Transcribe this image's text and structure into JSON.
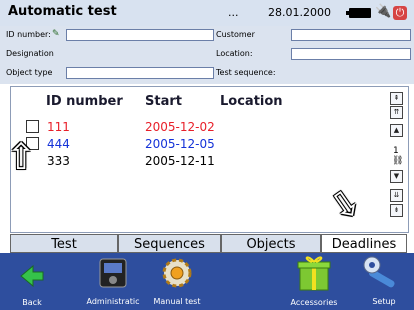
{
  "title": "Automatic test",
  "status": {
    "dots": "...",
    "date": "28.01.2000",
    "power_glyph": "⏻",
    "plug_glyph": "🔌"
  },
  "fields": {
    "id_number_label": "ID number:",
    "customer_label": "Customer",
    "designation_label": "Designation",
    "location_label": "Location:",
    "object_type_label": "Object type",
    "test_sequence_label": "Test sequence:",
    "id_number_value": "",
    "customer_value": "",
    "location_value": "",
    "object_type_value": "",
    "pen_glyph": "✎"
  },
  "table": {
    "columns": [
      "ID number",
      "Start",
      "Location"
    ],
    "rows": [
      {
        "id": "111",
        "start": "2005-12-02",
        "location": "",
        "color": "#e8202a"
      },
      {
        "id": "444",
        "start": "2005-12-05",
        "location": "",
        "color": "#1432d8"
      },
      {
        "id": "333",
        "start": "2005-12-11",
        "location": "",
        "color": "#000000"
      }
    ],
    "page": "1"
  },
  "scroll_glyphs": {
    "top": "⇞",
    "page_up": "⇈",
    "up": "▲",
    "link": "⛓",
    "down": "▼",
    "page_down": "⇊",
    "bottom": "⇟"
  },
  "arrows": {
    "left": "⇧",
    "right": "⇩"
  },
  "tabs": [
    "Test",
    "Sequences",
    "Objects",
    "Deadlines"
  ],
  "active_tab": 3,
  "toolbar": {
    "back": "Back",
    "administrative": "Administratic",
    "manual_test": "Manual test",
    "accessories": "Accessories",
    "setup": "Setup"
  },
  "colors": {
    "accent": "#2e4e9e",
    "title_bg": "#d8e2f0",
    "field_bg": "#dbe3ef"
  }
}
